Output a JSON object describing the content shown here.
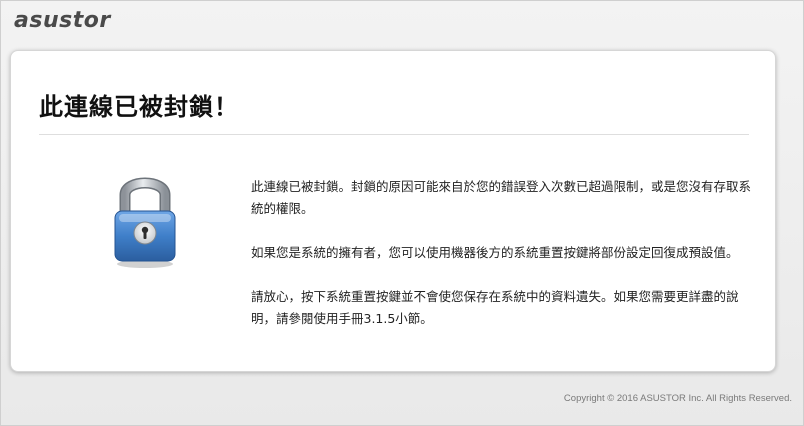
{
  "header": {
    "logo_text": "asustor"
  },
  "main": {
    "title": "此連線已被封鎖！",
    "lock_icon": "padlock-icon",
    "paragraphs": [
      "此連線已被封鎖。封鎖的原因可能來自於您的錯誤登入次數已超過限制，或是您沒有存取系統的權限。",
      "如果您是系統的擁有者，您可以使用機器後方的系統重置按鍵將部份設定回復成預設值。",
      "請放心，按下系統重置按鍵並不會使您保存在系統中的資料遺失。如果您需要更詳盡的說明，請參閱使用手冊3.1.5小節。"
    ]
  },
  "footer": {
    "copyright": "Copyright © 2016 ASUSTOR Inc. All Rights Reserved."
  },
  "colors": {
    "background": "#ececec",
    "card": "#ffffff",
    "lock_body": "#3f7fc9",
    "lock_shackle": "#b7bcc2"
  }
}
